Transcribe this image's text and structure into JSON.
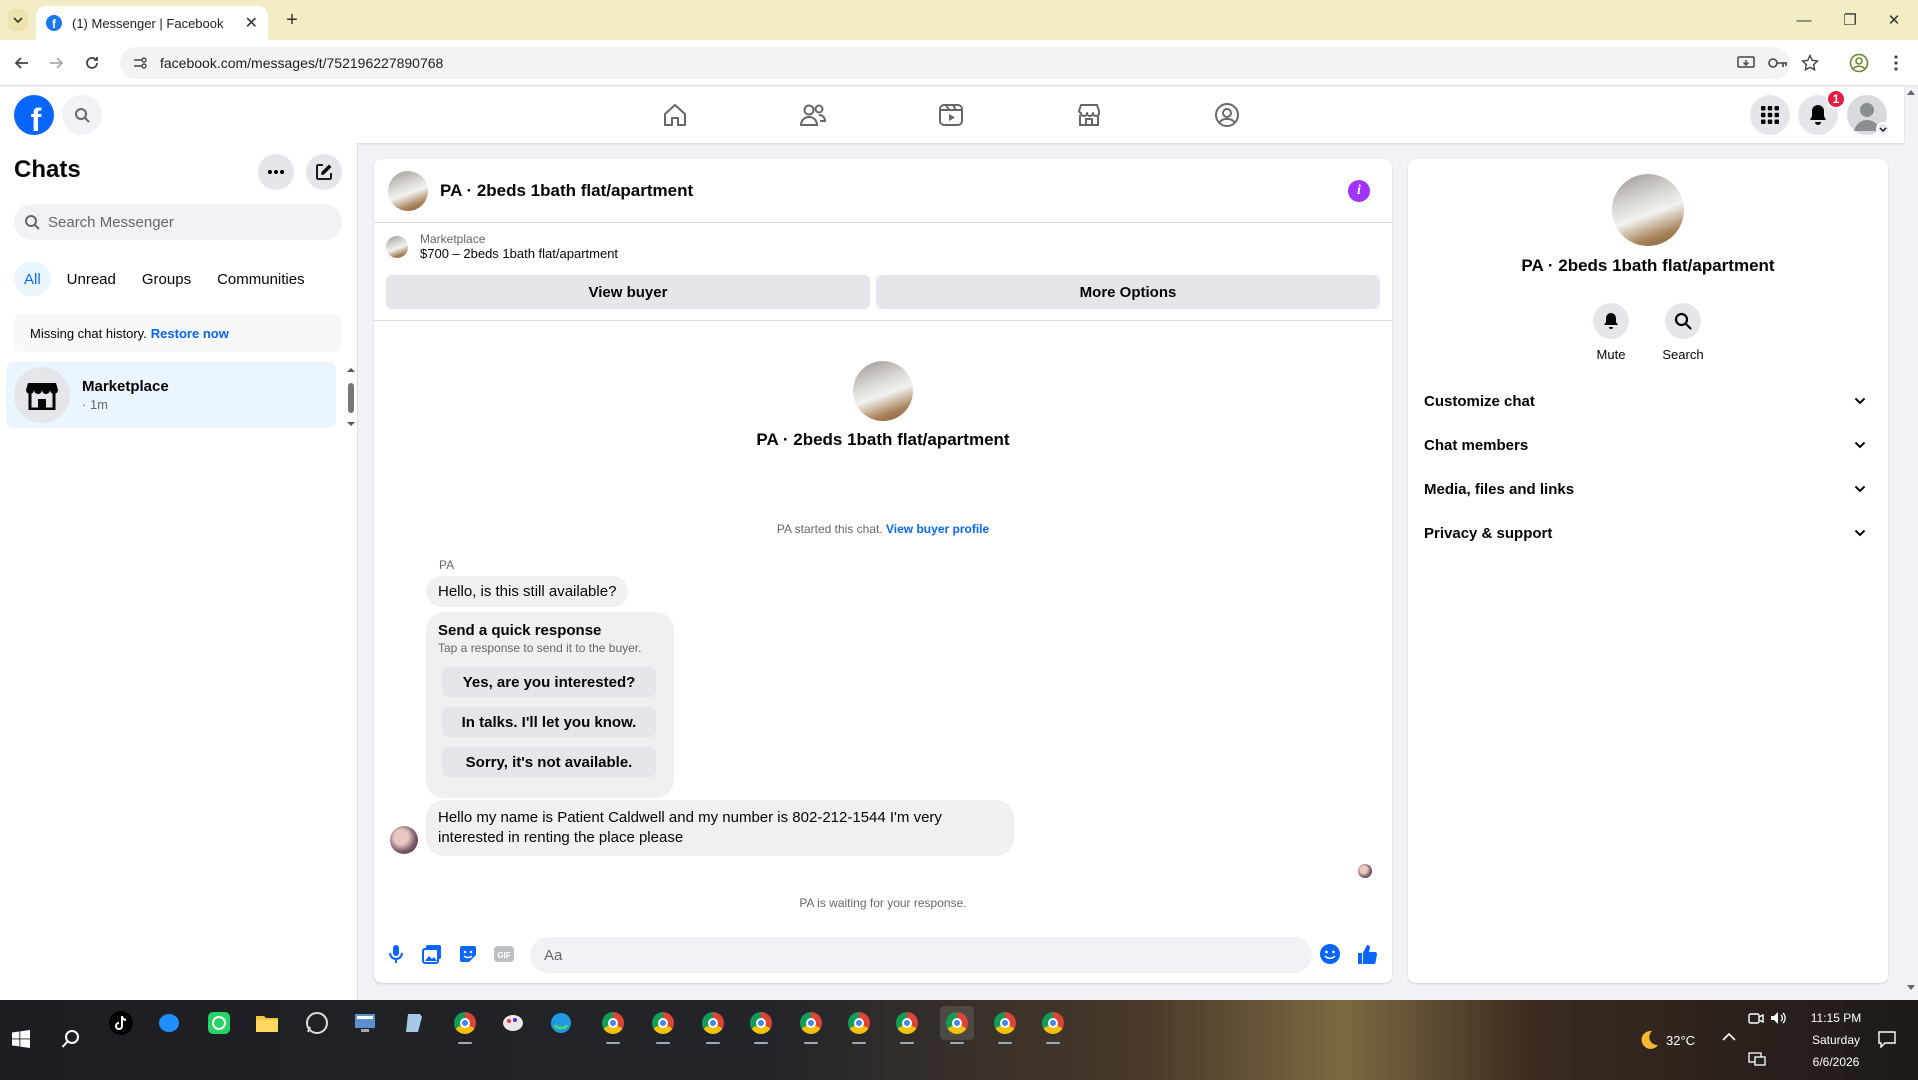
{
  "browser": {
    "tab_title": "(1) Messenger | Facebook",
    "url": "facebook.com/messages/t/752196227890768"
  },
  "fb_nav": {
    "notification_count": "1",
    "accent_color": "#0866ff"
  },
  "left": {
    "title": "Chats",
    "search_placeholder": "Search Messenger",
    "filters": [
      "All",
      "Unread",
      "Groups",
      "Communities"
    ],
    "notice_text": "Missing chat history.",
    "notice_link": "Restore now",
    "chat": {
      "name": "Marketplace",
      "time": "· 1m"
    }
  },
  "conversation": {
    "title": "PA · 2beds 1bath flat/apartment",
    "listing_source": "Marketplace",
    "listing_price_title": "$700 – 2beds 1bath flat/apartment",
    "view_buyer": "View buyer",
    "more_options": "More Options",
    "center_title": "PA · 2beds 1bath flat/apartment",
    "started_text": "PA started this chat.",
    "started_link": "View buyer profile",
    "sender_name": "PA",
    "message_1": "Hello, is this still available?",
    "quick_title": "Send a quick response",
    "quick_sub": "Tap a response to send it to the buyer.",
    "quick_options": [
      "Yes, are you interested?",
      "In talks. I'll let you know.",
      "Sorry, it's not available."
    ],
    "message_2": "Hello my name is Patient Caldwell and my number is 802-212-1544 I'm very interested in renting the place please",
    "waiting_text": "PA is waiting for your response.",
    "composer_placeholder": "Aa"
  },
  "right": {
    "name": "PA · 2beds 1bath flat/apartment",
    "actions": [
      "Mute",
      "Search"
    ],
    "sections": [
      "Customize chat",
      "Chat members",
      "Media, files and links",
      "Privacy & support"
    ]
  },
  "taskbar": {
    "temperature": "32°C",
    "time": "11:15 PM",
    "day": "Saturday",
    "date": "6/6/2026"
  }
}
